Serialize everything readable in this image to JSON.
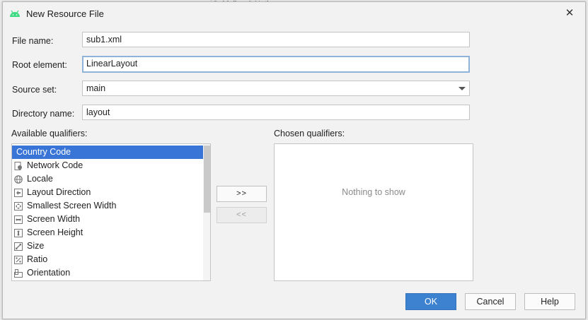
{
  "dialog": {
    "title": "New Resource File",
    "close_glyph": "✕",
    "icon": "android-icon"
  },
  "background": {
    "peek_text": "Guideline & Notice"
  },
  "form": {
    "file_name_label": "File name:",
    "file_name_value": "sub1.xml",
    "root_element_label": "Root element:",
    "root_element_value": "LinearLayout",
    "source_set_label": "Source set:",
    "source_set_value": "main",
    "directory_name_label": "Directory name:",
    "directory_name_value": "layout"
  },
  "qualifiers": {
    "available_label": "Available qualifiers:",
    "chosen_label": "Chosen qualifiers:",
    "chosen_empty": "Nothing to show",
    "add_label": ">>",
    "remove_label": "<<",
    "items": [
      {
        "label": "Country Code",
        "icon": "country-code-icon",
        "selected": true
      },
      {
        "label": "Network Code",
        "icon": "network-code-icon"
      },
      {
        "label": "Locale",
        "icon": "globe-icon"
      },
      {
        "label": "Layout Direction",
        "icon": "layout-direction-icon"
      },
      {
        "label": "Smallest Screen Width",
        "icon": "smallest-width-icon"
      },
      {
        "label": "Screen Width",
        "icon": "screen-width-icon"
      },
      {
        "label": "Screen Height",
        "icon": "screen-height-icon"
      },
      {
        "label": "Size",
        "icon": "size-icon"
      },
      {
        "label": "Ratio",
        "icon": "ratio-icon"
      },
      {
        "label": "Orientation",
        "icon": "orientation-icon"
      }
    ]
  },
  "buttons": {
    "ok": "OK",
    "cancel": "Cancel",
    "help": "Help"
  },
  "colors": {
    "selection": "#3875d7",
    "primary_button": "#3d82d0",
    "android_green": "#3ddc84"
  }
}
